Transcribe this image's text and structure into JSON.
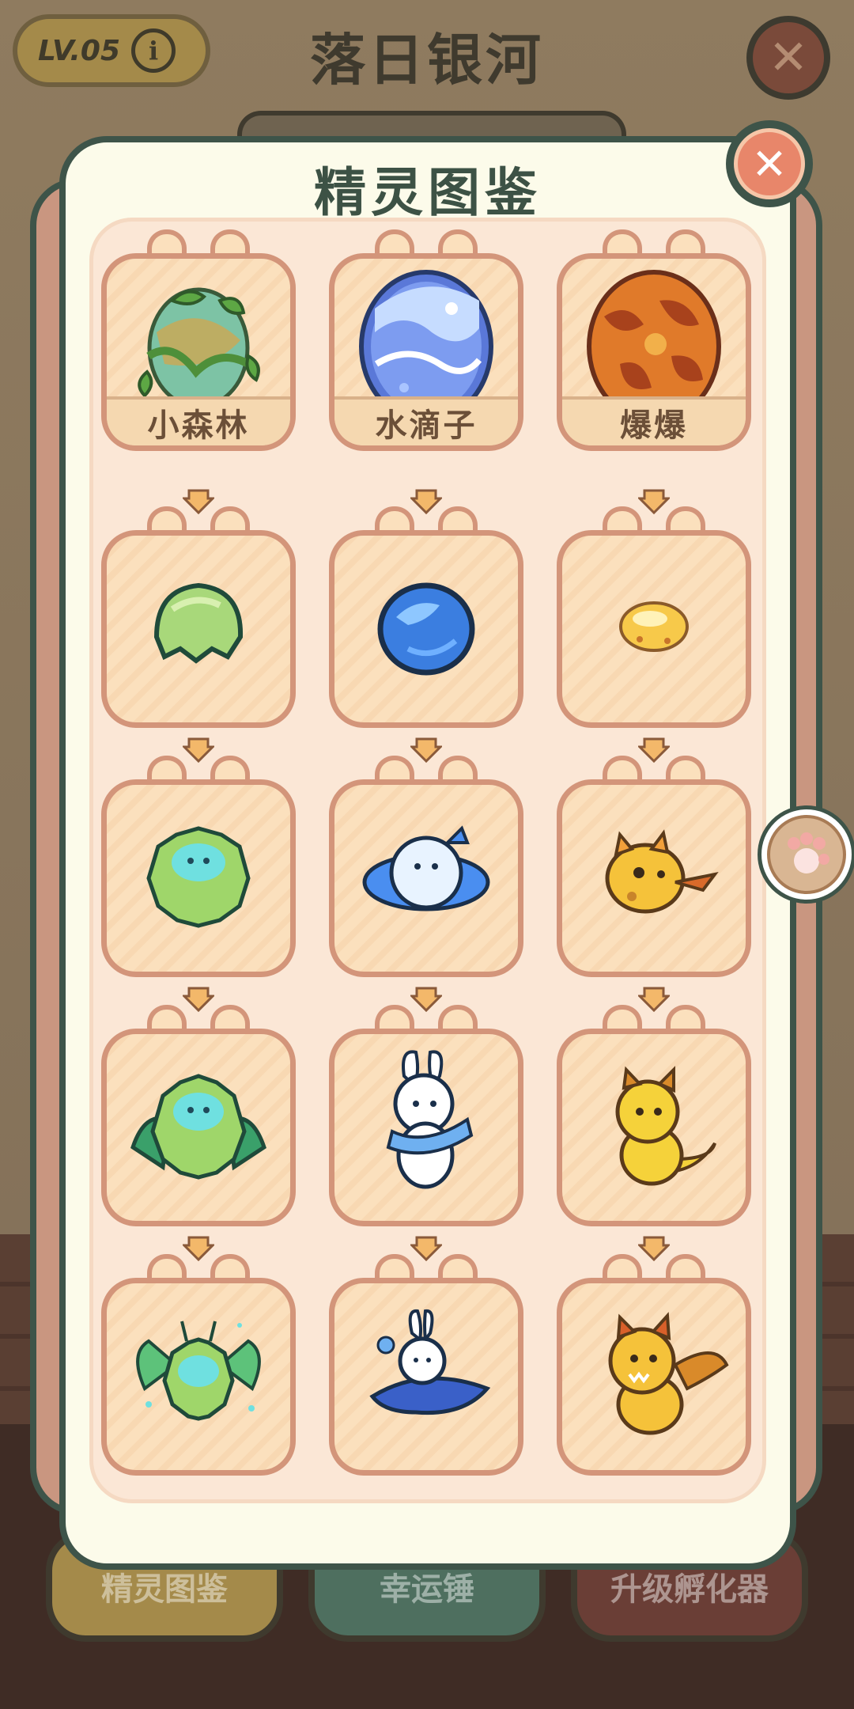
{
  "background": {
    "level_badge": "LV.05",
    "info_icon": "i",
    "scene_title": "落日银河",
    "buttons": [
      "精灵图鉴",
      "幸运锤",
      "升级孵化器"
    ]
  },
  "modal": {
    "title": "精灵图鉴",
    "columns": [
      {
        "egg_name": "小森林",
        "stages": [
          "forest-egg",
          "leaf-seed",
          "fluffy-sprite",
          "winged-fluffy-sprite",
          "forest-fairy"
        ]
      },
      {
        "egg_name": "水滴子",
        "stages": [
          "water-egg",
          "water-drop",
          "bubble-blob",
          "bunny-sprite",
          "ocean-bunny"
        ]
      },
      {
        "egg_name": "爆爆",
        "stages": [
          "lava-egg",
          "ember-seed",
          "fire-blob",
          "baby-dragon",
          "winged-dragon"
        ]
      }
    ]
  },
  "colors": {
    "accent_green": "#3e5449",
    "card_border": "#d3957a",
    "close_red": "#e8866a"
  }
}
